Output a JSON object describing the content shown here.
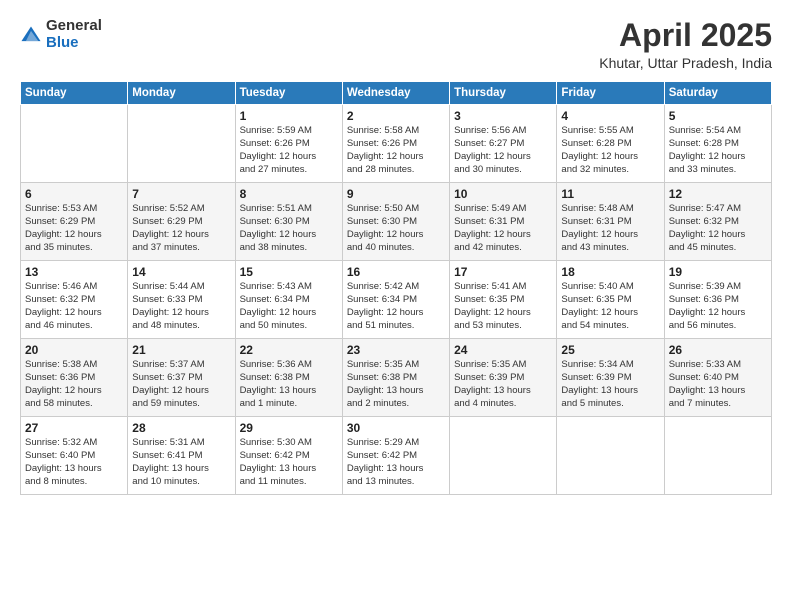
{
  "header": {
    "logo_general": "General",
    "logo_blue": "Blue",
    "month_title": "April 2025",
    "subtitle": "Khutar, Uttar Pradesh, India"
  },
  "days_of_week": [
    "Sunday",
    "Monday",
    "Tuesday",
    "Wednesday",
    "Thursday",
    "Friday",
    "Saturday"
  ],
  "weeks": [
    [
      {
        "day": "",
        "detail": ""
      },
      {
        "day": "",
        "detail": ""
      },
      {
        "day": "1",
        "detail": "Sunrise: 5:59 AM\nSunset: 6:26 PM\nDaylight: 12 hours\nand 27 minutes."
      },
      {
        "day": "2",
        "detail": "Sunrise: 5:58 AM\nSunset: 6:26 PM\nDaylight: 12 hours\nand 28 minutes."
      },
      {
        "day": "3",
        "detail": "Sunrise: 5:56 AM\nSunset: 6:27 PM\nDaylight: 12 hours\nand 30 minutes."
      },
      {
        "day": "4",
        "detail": "Sunrise: 5:55 AM\nSunset: 6:28 PM\nDaylight: 12 hours\nand 32 minutes."
      },
      {
        "day": "5",
        "detail": "Sunrise: 5:54 AM\nSunset: 6:28 PM\nDaylight: 12 hours\nand 33 minutes."
      }
    ],
    [
      {
        "day": "6",
        "detail": "Sunrise: 5:53 AM\nSunset: 6:29 PM\nDaylight: 12 hours\nand 35 minutes."
      },
      {
        "day": "7",
        "detail": "Sunrise: 5:52 AM\nSunset: 6:29 PM\nDaylight: 12 hours\nand 37 minutes."
      },
      {
        "day": "8",
        "detail": "Sunrise: 5:51 AM\nSunset: 6:30 PM\nDaylight: 12 hours\nand 38 minutes."
      },
      {
        "day": "9",
        "detail": "Sunrise: 5:50 AM\nSunset: 6:30 PM\nDaylight: 12 hours\nand 40 minutes."
      },
      {
        "day": "10",
        "detail": "Sunrise: 5:49 AM\nSunset: 6:31 PM\nDaylight: 12 hours\nand 42 minutes."
      },
      {
        "day": "11",
        "detail": "Sunrise: 5:48 AM\nSunset: 6:31 PM\nDaylight: 12 hours\nand 43 minutes."
      },
      {
        "day": "12",
        "detail": "Sunrise: 5:47 AM\nSunset: 6:32 PM\nDaylight: 12 hours\nand 45 minutes."
      }
    ],
    [
      {
        "day": "13",
        "detail": "Sunrise: 5:46 AM\nSunset: 6:32 PM\nDaylight: 12 hours\nand 46 minutes."
      },
      {
        "day": "14",
        "detail": "Sunrise: 5:44 AM\nSunset: 6:33 PM\nDaylight: 12 hours\nand 48 minutes."
      },
      {
        "day": "15",
        "detail": "Sunrise: 5:43 AM\nSunset: 6:34 PM\nDaylight: 12 hours\nand 50 minutes."
      },
      {
        "day": "16",
        "detail": "Sunrise: 5:42 AM\nSunset: 6:34 PM\nDaylight: 12 hours\nand 51 minutes."
      },
      {
        "day": "17",
        "detail": "Sunrise: 5:41 AM\nSunset: 6:35 PM\nDaylight: 12 hours\nand 53 minutes."
      },
      {
        "day": "18",
        "detail": "Sunrise: 5:40 AM\nSunset: 6:35 PM\nDaylight: 12 hours\nand 54 minutes."
      },
      {
        "day": "19",
        "detail": "Sunrise: 5:39 AM\nSunset: 6:36 PM\nDaylight: 12 hours\nand 56 minutes."
      }
    ],
    [
      {
        "day": "20",
        "detail": "Sunrise: 5:38 AM\nSunset: 6:36 PM\nDaylight: 12 hours\nand 58 minutes."
      },
      {
        "day": "21",
        "detail": "Sunrise: 5:37 AM\nSunset: 6:37 PM\nDaylight: 12 hours\nand 59 minutes."
      },
      {
        "day": "22",
        "detail": "Sunrise: 5:36 AM\nSunset: 6:38 PM\nDaylight: 13 hours\nand 1 minute."
      },
      {
        "day": "23",
        "detail": "Sunrise: 5:35 AM\nSunset: 6:38 PM\nDaylight: 13 hours\nand 2 minutes."
      },
      {
        "day": "24",
        "detail": "Sunrise: 5:35 AM\nSunset: 6:39 PM\nDaylight: 13 hours\nand 4 minutes."
      },
      {
        "day": "25",
        "detail": "Sunrise: 5:34 AM\nSunset: 6:39 PM\nDaylight: 13 hours\nand 5 minutes."
      },
      {
        "day": "26",
        "detail": "Sunrise: 5:33 AM\nSunset: 6:40 PM\nDaylight: 13 hours\nand 7 minutes."
      }
    ],
    [
      {
        "day": "27",
        "detail": "Sunrise: 5:32 AM\nSunset: 6:40 PM\nDaylight: 13 hours\nand 8 minutes."
      },
      {
        "day": "28",
        "detail": "Sunrise: 5:31 AM\nSunset: 6:41 PM\nDaylight: 13 hours\nand 10 minutes."
      },
      {
        "day": "29",
        "detail": "Sunrise: 5:30 AM\nSunset: 6:42 PM\nDaylight: 13 hours\nand 11 minutes."
      },
      {
        "day": "30",
        "detail": "Sunrise: 5:29 AM\nSunset: 6:42 PM\nDaylight: 13 hours\nand 13 minutes."
      },
      {
        "day": "",
        "detail": ""
      },
      {
        "day": "",
        "detail": ""
      },
      {
        "day": "",
        "detail": ""
      }
    ]
  ]
}
